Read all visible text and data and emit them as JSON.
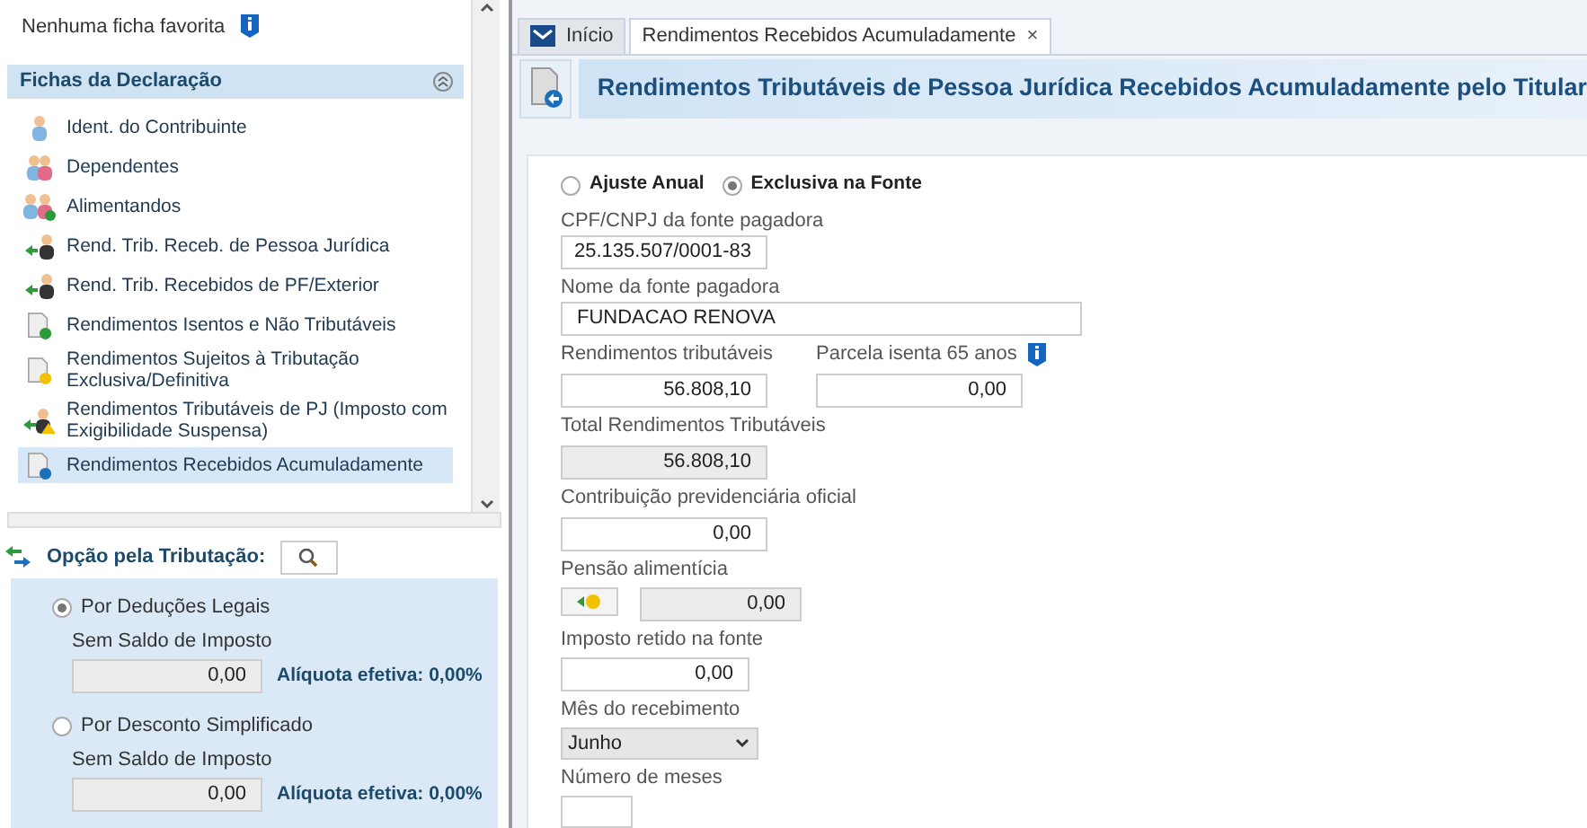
{
  "favorites": {
    "text": "Nenhuma ficha favorita"
  },
  "sidebar": {
    "title": "Fichas da Declaração",
    "expanded": true,
    "items": [
      {
        "label": "Ident. do Contribuinte",
        "kind": "person",
        "selected": false
      },
      {
        "label": "Dependentes",
        "kind": "people",
        "selected": false
      },
      {
        "label": "Alimentandos",
        "kind": "people-add",
        "selected": false
      },
      {
        "label": "Rend. Trib. Receb. de Pessoa Jurídica",
        "kind": "arrow-person",
        "selected": false
      },
      {
        "label": "Rend. Trib. Recebidos de PF/Exterior",
        "kind": "arrow-person",
        "selected": false
      },
      {
        "label": "Rendimentos Isentos e Não Tributáveis",
        "kind": "doc-check",
        "selected": false
      },
      {
        "label": "Rendimentos Sujeitos à Tributação Exclusiva/Definitiva",
        "kind": "doc-warning",
        "selected": false
      },
      {
        "label": "Rendimentos Tributáveis de PJ (Imposto com Exigibilidade Suspensa)",
        "kind": "arrow-warning",
        "selected": false
      },
      {
        "label": "Rendimentos Recebidos Acumuladamente",
        "kind": "doc-arrow",
        "selected": true
      }
    ]
  },
  "tax_option": {
    "title": "Opção pela Tributação:",
    "options": [
      {
        "label": "Por Deduções Legais",
        "selected": true,
        "status": "Sem Saldo de Imposto",
        "value": "0,00",
        "rate": "Alíquota efetiva: 0,00%"
      },
      {
        "label": "Por Desconto Simplificado",
        "selected": false,
        "status": "Sem Saldo de Imposto",
        "value": "0,00",
        "rate": "Alíquota efetiva: 0,00%"
      }
    ]
  },
  "tabs": [
    {
      "label": "Início",
      "selected": false,
      "closable": false
    },
    {
      "label": "Rendimentos Recebidos Acumuladamente",
      "selected": true,
      "closable": true,
      "close": "×"
    }
  ],
  "header": {
    "title": "Rendimentos Tributáveis de Pessoa Jurídica Recebidos Acumuladamente pelo Titular"
  },
  "form": {
    "regime": [
      {
        "label": "Ajuste Anual",
        "selected": false
      },
      {
        "label": "Exclusiva na Fonte",
        "selected": true
      }
    ],
    "cpf": {
      "label": "CPF/CNPJ da fonte pagadora",
      "value": "25.135.507/0001-83"
    },
    "nome": {
      "label": "Nome da fonte pagadora",
      "value": "FUNDACAO RENOVA"
    },
    "rendimentos": {
      "label": "Rendimentos tributáveis",
      "value": "56.808,10"
    },
    "parcela": {
      "label": "Parcela isenta 65 anos",
      "value": "0,00"
    },
    "total": {
      "label": "Total Rendimentos Tributáveis",
      "value": "56.808,10"
    },
    "contribuicao": {
      "label": "Contribuição previdenciária oficial",
      "value": "0,00"
    },
    "pensao": {
      "label": "Pensão alimentícia",
      "value": "0,00"
    },
    "imposto": {
      "label": "Imposto retido na fonte",
      "value": "0,00"
    },
    "mes": {
      "label": "Mês do recebimento",
      "value": "Junho"
    },
    "numero": {
      "label": "Número de meses"
    }
  }
}
